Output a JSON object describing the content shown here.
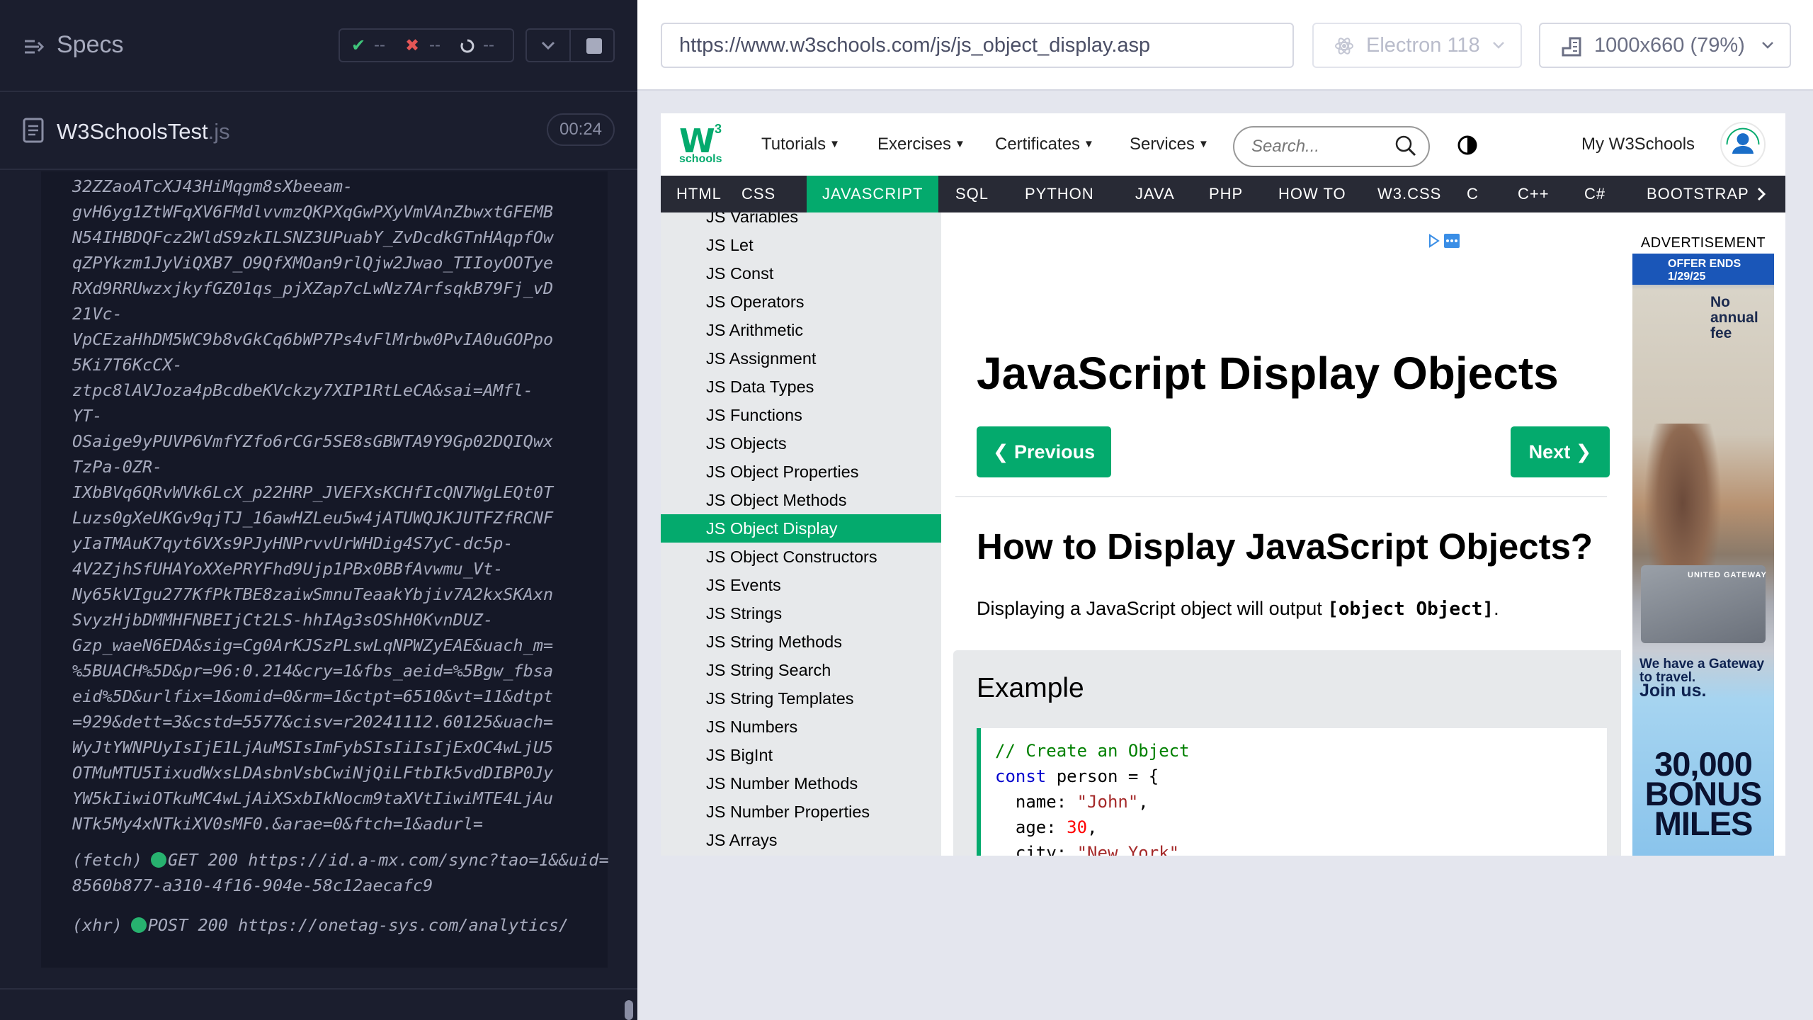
{
  "runner": {
    "specs_title": "Specs",
    "stats": {
      "pass_icon": "✔",
      "pass_count": "--",
      "fail_icon": "✖",
      "fail_count": "--",
      "pending_count": "--"
    },
    "spec_file": {
      "name": "W3SchoolsTest",
      "ext": ".js",
      "duration": "00:24"
    },
    "log_url": "32ZZaoATcXJ43HiMqgm8sXbeeam-\ngvH6yg1ZtWFqXV6FMdlvvmzQKPXqGwPXyVmVAnZbwxtGFEMB\nN54IHBDQFcz2WldS9zkILSNZ3UPuabY_ZvDcdkGTnHAqpfOw\nqZPYkzm1JyViQXB7_O9QfXMOan9rlQjw2Jwao_TIIoyOOTye\nRXd9RRUwzxjkyfGZ01qs_pjXZap7cLwNz7ArfsqkB79Fj_vD\n21Vc-\nVpCEzaHhDM5WC9b8vGkCq6bWP7Ps4vFlMrbw0PvIA0uGOPpo\n5Ki7T6KcCX-\nztpc8lAVJoza4pBcdbeKVckzy7XIP1RtLeCA&sai=AMfl-\nYT-\nOSaige9yPUVP6VmfYZfo6rCGr5SE8sGBWTA9Y9Gp02DQIQwx\nTzPa-0ZR-\nIXbBVq6QRvWVk6LcX_p22HRP_JVEFXsKCHfIcQN7WgLEQt0T\nLuzs0gXeUKGv9qjTJ_16awHZLeu5w4jATUWQJKJUTFZfRCNF\nyIaTMAuK7qyt6VXs9PJyHNPrvvUrWHDig4S7yC-dc5p-\n4V2ZjhSfUHAYoXXePRYFhd9Ujp1PBx0BBfAvwmu_Vt-\nNy65kVIgu277KfPkTBE8zaiwSmnuTeaakYbjiv7A2kxSKAxn\nSvyzHjbDMMHFNBEIjCt2LS-hhIAg3sOShH0KvnDUZ-\nGzp_waeN6EDA&sig=Cg0ArKJSzPLswLqNPWZyEAE&uach_m=\n%5BUACH%5D&pr=96:0.214&cry=1&fbs_aeid=%5Bgw_fbsa\neid%5D&urlfix=1&omid=0&rm=1&ctpt=6510&vt=11&dtpt\n=929&dett=3&cstd=5577&cisv=r20241112.60125&uach=\nWyJtYWNPUyIsIjE1LjAuMSIsImFybSIsIiIsIjExOC4wLjU5\nOTMuMTU5IixudWxsLDAsbnVsbCwiNjQiLFtbIk5vdDIBP0Jy\nYW5kIiwiOTkuMC4wLjAiXSxbIkNocm9taXVtIiwiMTE4LjAu\nNTk5My4xNTkiXV0sMF0.&arae=0&ftch=1&adurl=",
    "requests": [
      {
        "type": "(fetch)",
        "method": "GET",
        "status": "200",
        "url": "https://id.a-mx.com/sync?tao=1&&uid=8560b877-a310-4f16-904e-58c12aecafc9"
      },
      {
        "type": "(xhr)",
        "method": "POST",
        "status": "200",
        "url": "https://onetag-sys.com/analytics/"
      }
    ]
  },
  "toolbar": {
    "url": "https://www.w3schools.com/js/js_object_display.asp",
    "browser": "Electron 118",
    "viewport": "1000x660",
    "zoom": "(79%)"
  },
  "site": {
    "logo_super": "3",
    "logo_text": "schools",
    "menu": [
      "Tutorials",
      "Exercises",
      "Certificates",
      "Services"
    ],
    "search_placeholder": "Search...",
    "my_account": "My W3Schools",
    "subnav": [
      "HTML",
      "CSS",
      "JAVASCRIPT",
      "SQL",
      "PYTHON",
      "JAVA",
      "PHP",
      "HOW TO",
      "W3.CSS",
      "C",
      "C++",
      "C#",
      "BOOTSTRAP"
    ],
    "active_subnav": "JAVASCRIPT",
    "sidebar": [
      "JS Variables",
      "JS Let",
      "JS Const",
      "JS Operators",
      "JS Arithmetic",
      "JS Assignment",
      "JS Data Types",
      "JS Functions",
      "JS Objects",
      "JS Object Properties",
      "JS Object Methods",
      "JS Object Display",
      "JS Object Constructors",
      "JS Events",
      "JS Strings",
      "JS String Methods",
      "JS String Search",
      "JS String Templates",
      "JS Numbers",
      "JS BigInt",
      "JS Number Methods",
      "JS Number Properties",
      "JS Arrays"
    ],
    "active_sidebar": "JS Object Display",
    "page_title": "JavaScript Display Objects",
    "prev_label": "Previous",
    "next_label": "Next",
    "heading": "How to Display JavaScript Objects?",
    "para_pre": "Displaying a JavaScript object will output ",
    "para_bold": "[object Object]",
    "para_post": ".",
    "example_title": "Example",
    "code": {
      "comment": "// Create an Object",
      "kw": "const",
      "decl": " person = {",
      "l3a": "  name: ",
      "l3s": "\"John\"",
      "l3e": ",",
      "l4a": "  age: ",
      "l4n": "30",
      "l4e": ",",
      "l5a": "  city: ",
      "l5s": "\"New York\""
    },
    "advertisement_label": "ADVERTISEMENT",
    "ad": {
      "offer": "OFFER ENDS 1/29/25",
      "annual": "No annual fee",
      "card": "UNITED GATEWAY",
      "gateway": "We have a Gateway to travel.",
      "join": "Join us.",
      "bonus": "30,000 BONUS MILES"
    }
  },
  "colors": {
    "brand_green": "#04aa6d",
    "runner_bg": "#1b1e2e",
    "subnav_bg": "#282a35"
  }
}
